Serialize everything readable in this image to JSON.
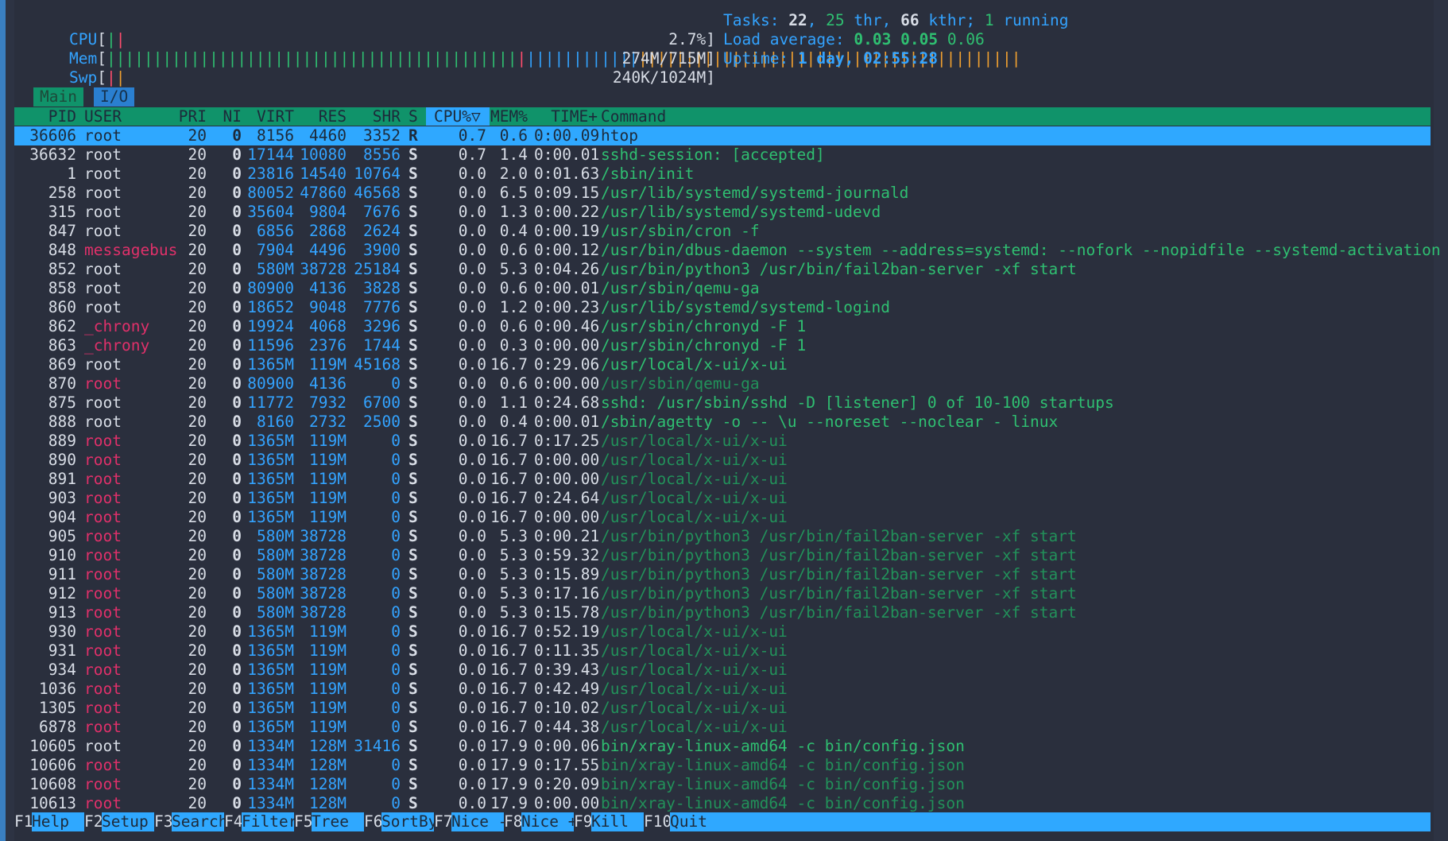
{
  "meters": {
    "cpu": {
      "label": "CPU",
      "percent": "2.7%",
      "fraction": 0.027
    },
    "mem": {
      "label": "Mem",
      "value": "274M/715M",
      "fraction": 0.38
    },
    "swp": {
      "label": "Swp",
      "value": "240K/1024M",
      "fraction": 0.0002
    }
  },
  "summary": {
    "tasks_label": "Tasks:",
    "tasks": "22",
    "thr": "25",
    "thr_label": "thr",
    "kthr": "66",
    "kthr_label": "kthr;",
    "running": "1",
    "running_label": "running",
    "load_label": "Load average:",
    "load1": "0.03",
    "load5": "0.05",
    "load15": "0.06",
    "uptime_label": "Uptime:",
    "uptime": "1 day, 02:55:28"
  },
  "tabs": [
    "Main",
    "I/O"
  ],
  "columns": [
    "PID",
    "USER",
    "PRI",
    "NI",
    "VIRT",
    "RES",
    "SHR",
    "S",
    "CPU%▽",
    "MEM%",
    "TIME+",
    "Command"
  ],
  "processes": [
    {
      "pid": "36606",
      "user": "root",
      "pri": "20",
      "ni": "0",
      "virt": "8156",
      "res": "4460",
      "shr": "3352",
      "s": "R",
      "cpu": "0.7",
      "mem": "0.6",
      "time": "0:00.09",
      "cmd": "htop",
      "selected": true
    },
    {
      "pid": "36632",
      "user": "root",
      "pri": "20",
      "ni": "0",
      "virt": "17144",
      "res": "10080",
      "shr": "8556",
      "s": "S",
      "cpu": "0.7",
      "mem": "1.4",
      "time": "0:00.01",
      "cmd": "sshd-session: [accepted]"
    },
    {
      "pid": "1",
      "user": "root",
      "pri": "20",
      "ni": "0",
      "virt": "23816",
      "res": "14540",
      "shr": "10764",
      "s": "S",
      "cpu": "0.0",
      "mem": "2.0",
      "time": "0:01.63",
      "cmd": "/sbin/init"
    },
    {
      "pid": "258",
      "user": "root",
      "pri": "20",
      "ni": "0",
      "virt": "80052",
      "res": "47860",
      "shr": "46568",
      "s": "S",
      "cpu": "0.0",
      "mem": "6.5",
      "time": "0:09.15",
      "cmd": "/usr/lib/systemd/systemd-journald"
    },
    {
      "pid": "315",
      "user": "root",
      "pri": "20",
      "ni": "0",
      "virt": "35604",
      "res": "9804",
      "shr": "7676",
      "s": "S",
      "cpu": "0.0",
      "mem": "1.3",
      "time": "0:00.22",
      "cmd": "/usr/lib/systemd/systemd-udevd"
    },
    {
      "pid": "847",
      "user": "root",
      "pri": "20",
      "ni": "0",
      "virt": "6856",
      "res": "2868",
      "shr": "2624",
      "s": "S",
      "cpu": "0.0",
      "mem": "0.4",
      "time": "0:00.19",
      "cmd": "/usr/sbin/cron -f"
    },
    {
      "pid": "848",
      "user": "messagebus",
      "pri": "20",
      "ni": "0",
      "virt": "7904",
      "res": "4496",
      "shr": "3900",
      "s": "S",
      "cpu": "0.0",
      "mem": "0.6",
      "time": "0:00.12",
      "cmd": "/usr/bin/dbus-daemon --system --address=systemd: --nofork --nopidfile --systemd-activation --sy"
    },
    {
      "pid": "852",
      "user": "root",
      "pri": "20",
      "ni": "0",
      "virt": "580M",
      "res": "38728",
      "shr": "25184",
      "s": "S",
      "cpu": "0.0",
      "mem": "5.3",
      "time": "0:04.26",
      "cmd": "/usr/bin/python3 /usr/bin/fail2ban-server -xf start"
    },
    {
      "pid": "858",
      "user": "root",
      "pri": "20",
      "ni": "0",
      "virt": "80900",
      "res": "4136",
      "shr": "3828",
      "s": "S",
      "cpu": "0.0",
      "mem": "0.6",
      "time": "0:00.01",
      "cmd": "/usr/sbin/qemu-ga"
    },
    {
      "pid": "860",
      "user": "root",
      "pri": "20",
      "ni": "0",
      "virt": "18652",
      "res": "9048",
      "shr": "7776",
      "s": "S",
      "cpu": "0.0",
      "mem": "1.2",
      "time": "0:00.23",
      "cmd": "/usr/lib/systemd/systemd-logind"
    },
    {
      "pid": "862",
      "user": "_chrony",
      "pri": "20",
      "ni": "0",
      "virt": "19924",
      "res": "4068",
      "shr": "3296",
      "s": "S",
      "cpu": "0.0",
      "mem": "0.6",
      "time": "0:00.46",
      "cmd": "/usr/sbin/chronyd -F 1"
    },
    {
      "pid": "863",
      "user": "_chrony",
      "pri": "20",
      "ni": "0",
      "virt": "11596",
      "res": "2376",
      "shr": "1744",
      "s": "S",
      "cpu": "0.0",
      "mem": "0.3",
      "time": "0:00.00",
      "cmd": "/usr/sbin/chronyd -F 1"
    },
    {
      "pid": "869",
      "user": "root",
      "pri": "20",
      "ni": "0",
      "virt": "1365M",
      "res": "119M",
      "shr": "45168",
      "s": "S",
      "cpu": "0.0",
      "mem": "16.7",
      "time": "0:29.06",
      "cmd": "/usr/local/x-ui/x-ui"
    },
    {
      "pid": "870",
      "user": "root",
      "pri": "20",
      "ni": "0",
      "virt": "80900",
      "res": "4136",
      "shr": "0",
      "s": "S",
      "cpu": "0.0",
      "mem": "0.6",
      "time": "0:00.00",
      "cmd": "/usr/sbin/qemu-ga",
      "thread": true
    },
    {
      "pid": "875",
      "user": "root",
      "pri": "20",
      "ni": "0",
      "virt": "11772",
      "res": "7932",
      "shr": "6700",
      "s": "S",
      "cpu": "0.0",
      "mem": "1.1",
      "time": "0:24.68",
      "cmd": "sshd: /usr/sbin/sshd -D [listener] 0 of 10-100 startups"
    },
    {
      "pid": "888",
      "user": "root",
      "pri": "20",
      "ni": "0",
      "virt": "8160",
      "res": "2732",
      "shr": "2500",
      "s": "S",
      "cpu": "0.0",
      "mem": "0.4",
      "time": "0:00.01",
      "cmd": "/sbin/agetty -o -- \\u --noreset --noclear - linux"
    },
    {
      "pid": "889",
      "user": "root",
      "pri": "20",
      "ni": "0",
      "virt": "1365M",
      "res": "119M",
      "shr": "0",
      "s": "S",
      "cpu": "0.0",
      "mem": "16.7",
      "time": "0:17.25",
      "cmd": "/usr/local/x-ui/x-ui",
      "thread": true
    },
    {
      "pid": "890",
      "user": "root",
      "pri": "20",
      "ni": "0",
      "virt": "1365M",
      "res": "119M",
      "shr": "0",
      "s": "S",
      "cpu": "0.0",
      "mem": "16.7",
      "time": "0:00.00",
      "cmd": "/usr/local/x-ui/x-ui",
      "thread": true
    },
    {
      "pid": "891",
      "user": "root",
      "pri": "20",
      "ni": "0",
      "virt": "1365M",
      "res": "119M",
      "shr": "0",
      "s": "S",
      "cpu": "0.0",
      "mem": "16.7",
      "time": "0:00.00",
      "cmd": "/usr/local/x-ui/x-ui",
      "thread": true
    },
    {
      "pid": "903",
      "user": "root",
      "pri": "20",
      "ni": "0",
      "virt": "1365M",
      "res": "119M",
      "shr": "0",
      "s": "S",
      "cpu": "0.0",
      "mem": "16.7",
      "time": "0:24.64",
      "cmd": "/usr/local/x-ui/x-ui",
      "thread": true
    },
    {
      "pid": "904",
      "user": "root",
      "pri": "20",
      "ni": "0",
      "virt": "1365M",
      "res": "119M",
      "shr": "0",
      "s": "S",
      "cpu": "0.0",
      "mem": "16.7",
      "time": "0:00.00",
      "cmd": "/usr/local/x-ui/x-ui",
      "thread": true
    },
    {
      "pid": "905",
      "user": "root",
      "pri": "20",
      "ni": "0",
      "virt": "580M",
      "res": "38728",
      "shr": "0",
      "s": "S",
      "cpu": "0.0",
      "mem": "5.3",
      "time": "0:00.21",
      "cmd": "/usr/bin/python3 /usr/bin/fail2ban-server -xf start",
      "thread": true
    },
    {
      "pid": "910",
      "user": "root",
      "pri": "20",
      "ni": "0",
      "virt": "580M",
      "res": "38728",
      "shr": "0",
      "s": "S",
      "cpu": "0.0",
      "mem": "5.3",
      "time": "0:59.32",
      "cmd": "/usr/bin/python3 /usr/bin/fail2ban-server -xf start",
      "thread": true
    },
    {
      "pid": "911",
      "user": "root",
      "pri": "20",
      "ni": "0",
      "virt": "580M",
      "res": "38728",
      "shr": "0",
      "s": "S",
      "cpu": "0.0",
      "mem": "5.3",
      "time": "0:15.89",
      "cmd": "/usr/bin/python3 /usr/bin/fail2ban-server -xf start",
      "thread": true
    },
    {
      "pid": "912",
      "user": "root",
      "pri": "20",
      "ni": "0",
      "virt": "580M",
      "res": "38728",
      "shr": "0",
      "s": "S",
      "cpu": "0.0",
      "mem": "5.3",
      "time": "0:17.16",
      "cmd": "/usr/bin/python3 /usr/bin/fail2ban-server -xf start",
      "thread": true
    },
    {
      "pid": "913",
      "user": "root",
      "pri": "20",
      "ni": "0",
      "virt": "580M",
      "res": "38728",
      "shr": "0",
      "s": "S",
      "cpu": "0.0",
      "mem": "5.3",
      "time": "0:15.78",
      "cmd": "/usr/bin/python3 /usr/bin/fail2ban-server -xf start",
      "thread": true
    },
    {
      "pid": "930",
      "user": "root",
      "pri": "20",
      "ni": "0",
      "virt": "1365M",
      "res": "119M",
      "shr": "0",
      "s": "S",
      "cpu": "0.0",
      "mem": "16.7",
      "time": "0:52.19",
      "cmd": "/usr/local/x-ui/x-ui",
      "thread": true
    },
    {
      "pid": "931",
      "user": "root",
      "pri": "20",
      "ni": "0",
      "virt": "1365M",
      "res": "119M",
      "shr": "0",
      "s": "S",
      "cpu": "0.0",
      "mem": "16.7",
      "time": "0:11.35",
      "cmd": "/usr/local/x-ui/x-ui",
      "thread": true
    },
    {
      "pid": "934",
      "user": "root",
      "pri": "20",
      "ni": "0",
      "virt": "1365M",
      "res": "119M",
      "shr": "0",
      "s": "S",
      "cpu": "0.0",
      "mem": "16.7",
      "time": "0:39.43",
      "cmd": "/usr/local/x-ui/x-ui",
      "thread": true
    },
    {
      "pid": "1036",
      "user": "root",
      "pri": "20",
      "ni": "0",
      "virt": "1365M",
      "res": "119M",
      "shr": "0",
      "s": "S",
      "cpu": "0.0",
      "mem": "16.7",
      "time": "0:42.49",
      "cmd": "/usr/local/x-ui/x-ui",
      "thread": true
    },
    {
      "pid": "1305",
      "user": "root",
      "pri": "20",
      "ni": "0",
      "virt": "1365M",
      "res": "119M",
      "shr": "0",
      "s": "S",
      "cpu": "0.0",
      "mem": "16.7",
      "time": "0:10.02",
      "cmd": "/usr/local/x-ui/x-ui",
      "thread": true
    },
    {
      "pid": "6878",
      "user": "root",
      "pri": "20",
      "ni": "0",
      "virt": "1365M",
      "res": "119M",
      "shr": "0",
      "s": "S",
      "cpu": "0.0",
      "mem": "16.7",
      "time": "0:44.38",
      "cmd": "/usr/local/x-ui/x-ui",
      "thread": true
    },
    {
      "pid": "10605",
      "user": "root",
      "pri": "20",
      "ni": "0",
      "virt": "1334M",
      "res": "128M",
      "shr": "31416",
      "s": "S",
      "cpu": "0.0",
      "mem": "17.9",
      "time": "0:00.06",
      "cmd": "bin/xray-linux-amd64 -c bin/config.json"
    },
    {
      "pid": "10606",
      "user": "root",
      "pri": "20",
      "ni": "0",
      "virt": "1334M",
      "res": "128M",
      "shr": "0",
      "s": "S",
      "cpu": "0.0",
      "mem": "17.9",
      "time": "0:17.55",
      "cmd": "bin/xray-linux-amd64 -c bin/config.json",
      "thread": true
    },
    {
      "pid": "10608",
      "user": "root",
      "pri": "20",
      "ni": "0",
      "virt": "1334M",
      "res": "128M",
      "shr": "0",
      "s": "S",
      "cpu": "0.0",
      "mem": "17.9",
      "time": "0:20.09",
      "cmd": "bin/xray-linux-amd64 -c bin/config.json",
      "thread": true
    },
    {
      "pid": "10613",
      "user": "root",
      "pri": "20",
      "ni": "0",
      "virt": "1334M",
      "res": "128M",
      "shr": "0",
      "s": "S",
      "cpu": "0.0",
      "mem": "17.9",
      "time": "0:00.00",
      "cmd": "bin/xray-linux-amd64 -c bin/config.json",
      "thread": true
    }
  ],
  "footer": [
    {
      "key": "F1",
      "label": "Help  "
    },
    {
      "key": "F2",
      "label": "Setup "
    },
    {
      "key": "F3",
      "label": "Search"
    },
    {
      "key": "F4",
      "label": "Filter"
    },
    {
      "key": "F5",
      "label": "Tree  "
    },
    {
      "key": "F6",
      "label": "SortBy"
    },
    {
      "key": "F7",
      "label": "Nice -"
    },
    {
      "key": "F8",
      "label": "Nice +"
    },
    {
      "key": "F9",
      "label": "Kill  "
    },
    {
      "key": "F10",
      "label": "Quit"
    }
  ],
  "colors": {
    "background": "#2a2f3d",
    "accent": "#2fa8ff",
    "header": "#10936a",
    "text": "#d8dde6"
  }
}
